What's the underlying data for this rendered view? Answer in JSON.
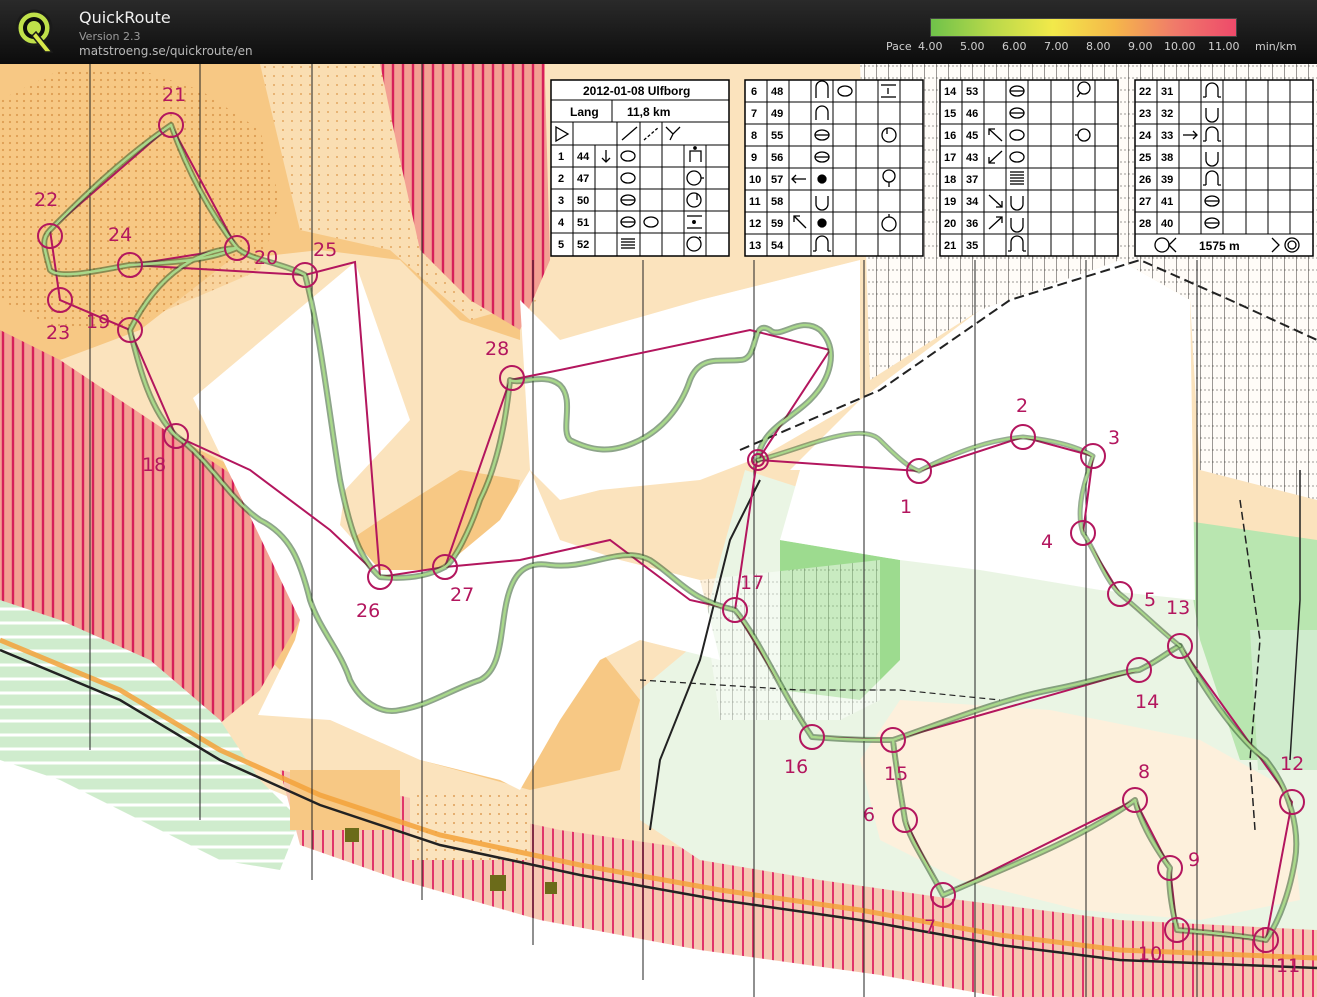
{
  "app": {
    "title": "QuickRoute",
    "version": "Version 2.3",
    "url": "matstroeng.se/quickroute/en"
  },
  "pace": {
    "label": "Pace",
    "ticks": [
      "4.00",
      "5.00",
      "6.00",
      "7.00",
      "8.00",
      "9.00",
      "10.00",
      "11.00"
    ],
    "unit": "min/km",
    "gradient": [
      "#6fc24a",
      "#b9d94a",
      "#f2e94a",
      "#f5b84a",
      "#f07a6a",
      "#ee4a6a"
    ]
  },
  "colors": {
    "course": "#b3165e",
    "route": "#4f7a3a",
    "map_yellow": "#f7c884",
    "map_pale": "#fbe3bd",
    "forbidden": "#e0356b",
    "green": "#6cc04a",
    "field": "#b8e8b8"
  },
  "course": {
    "title": "2012-01-08 Ulfborg",
    "class_name": "Lang",
    "length": "11,8 km",
    "finish_distance": "1575 m",
    "controls": [
      {
        "n": "1",
        "code": "44"
      },
      {
        "n": "2",
        "code": "47"
      },
      {
        "n": "3",
        "code": "50"
      },
      {
        "n": "4",
        "code": "51"
      },
      {
        "n": "5",
        "code": "52"
      },
      {
        "n": "6",
        "code": "48"
      },
      {
        "n": "7",
        "code": "49"
      },
      {
        "n": "8",
        "code": "55"
      },
      {
        "n": "9",
        "code": "56"
      },
      {
        "n": "10",
        "code": "57"
      },
      {
        "n": "11",
        "code": "58"
      },
      {
        "n": "12",
        "code": "59"
      },
      {
        "n": "13",
        "code": "54"
      },
      {
        "n": "14",
        "code": "53"
      },
      {
        "n": "15",
        "code": "46"
      },
      {
        "n": "16",
        "code": "45"
      },
      {
        "n": "17",
        "code": "43"
      },
      {
        "n": "18",
        "code": "37"
      },
      {
        "n": "19",
        "code": "34"
      },
      {
        "n": "20",
        "code": "36"
      },
      {
        "n": "21",
        "code": "35"
      },
      {
        "n": "22",
        "code": "31"
      },
      {
        "n": "23",
        "code": "32"
      },
      {
        "n": "24",
        "code": "33"
      },
      {
        "n": "25",
        "code": "38"
      },
      {
        "n": "26",
        "code": "39"
      },
      {
        "n": "27",
        "code": "41"
      },
      {
        "n": "28",
        "code": "40"
      }
    ]
  }
}
